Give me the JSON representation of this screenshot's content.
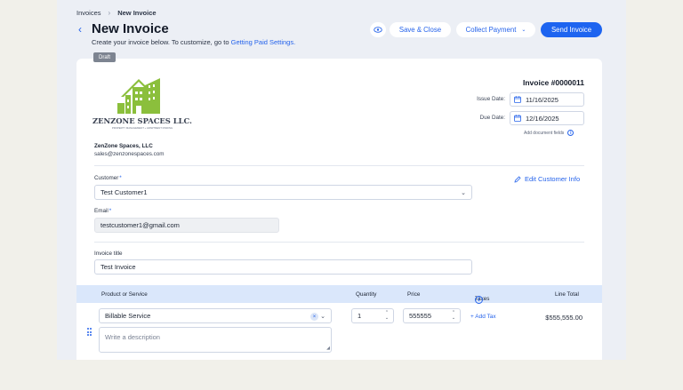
{
  "breadcrumb": {
    "parent": "Invoices",
    "current": "New Invoice"
  },
  "page": {
    "title": "New Invoice",
    "subtitle_text": "Create your invoice below. To customize, go to ",
    "subtitle_link": "Getting Paid Settings."
  },
  "actions": {
    "preview_icon": "eye-icon",
    "save_close": "Save & Close",
    "collect_payment": "Collect Payment",
    "send_invoice": "Send Invoice"
  },
  "status_badge": "Draft",
  "business": {
    "logo_text": "ZENZONE SPACES LLC.",
    "logo_tagline": "PROPERTY MANAGEMENT + APARTMENT FINDING",
    "name": "ZenZone Spaces, LLC",
    "email": "sales@zenzonespaces.com"
  },
  "invoice": {
    "number": "Invoice #0000011",
    "issue_date_label": "Issue Date:",
    "issue_date": "11/16/2025",
    "due_date_label": "Due Date:",
    "due_date": "12/16/2025",
    "add_fields": "Add document fields"
  },
  "customer": {
    "label": "Customer",
    "value": "Test Customer1",
    "edit_link": "Edit Customer Info",
    "email_label": "Email",
    "email": "testcustomer1@gmail.com"
  },
  "title_field": {
    "label": "Invoice title",
    "value": "Test Invoice"
  },
  "table": {
    "headers": [
      "Product or Service",
      "Quantity",
      "Price",
      "Taxes",
      "Line Total"
    ],
    "rows": [
      {
        "product": "Billable Service",
        "quantity": "1",
        "price": "555555",
        "add_tax": "+ Add Tax",
        "line_total": "$555,555.00",
        "description_placeholder": "Write a description"
      }
    ]
  },
  "colors": {
    "accent": "#1d64f0",
    "logo_green": "#8bbf3c",
    "logo_text": "#3a4252",
    "table_header": "#dae7fb"
  }
}
